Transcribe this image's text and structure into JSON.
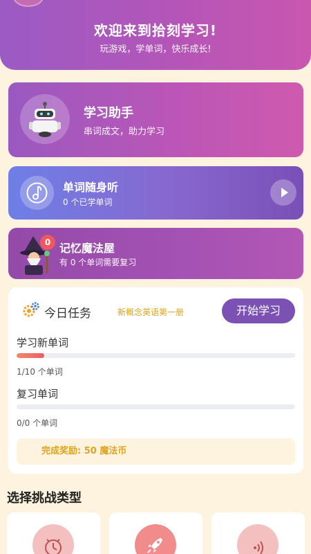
{
  "header": {
    "title": "欢迎来到拾刻学习!",
    "subtitle": "玩游戏，学单词，快乐成长!"
  },
  "assistant_card": {
    "name": "学习助手",
    "desc": "串词成文，助力学习",
    "icon": "robot-icon"
  },
  "listen_card": {
    "name": "单词随身听",
    "desc": "0 个已学单词",
    "icon": "music-note-icon",
    "action_icon": "play-icon"
  },
  "magic_card": {
    "name": "记忆魔法屋",
    "desc": "有 0 个单词需要复习",
    "badge": "0",
    "icon": "wizard-icon"
  },
  "task": {
    "heading": "今日任务",
    "book": "新概念英语第一册",
    "start_label": "开始学习",
    "new_words": {
      "label": "学习新单词",
      "count_text": "1/10 个单词",
      "progress": 0.1
    },
    "review_words": {
      "label": "复习单词",
      "count_text": "0/0 个单词",
      "progress": 0
    },
    "reward": "完成奖励: 50 魔法币"
  },
  "challenge": {
    "title": "选择挑战类型",
    "types": [
      {
        "icon": "timer-icon",
        "color": "#f3bfbf"
      },
      {
        "icon": "rocket-icon",
        "color": "#f08c8c"
      },
      {
        "icon": "sound-icon",
        "color": "#f3bfbf"
      }
    ]
  },
  "colors": {
    "accent": "#7b52b4",
    "background": "#fdf3de",
    "reward_text": "#e0a420",
    "progress": "#ef5a66"
  }
}
